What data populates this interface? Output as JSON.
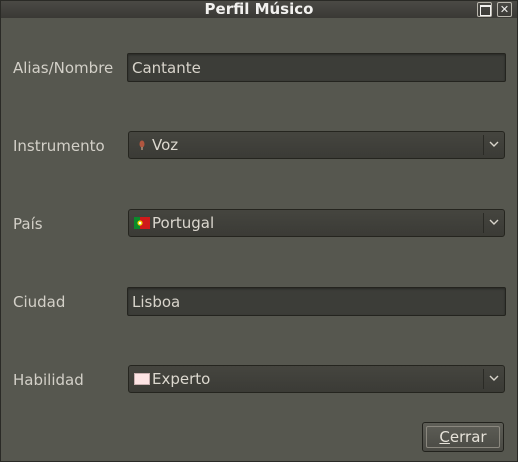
{
  "window": {
    "title": "Perfil Músico",
    "maximize_icon": "maximize-icon",
    "close_icon": "close-icon",
    "close_glyph": "✕"
  },
  "form": {
    "alias": {
      "label": "Alias/Nombre",
      "value": "Cantante"
    },
    "instrumento": {
      "label": "Instrumento",
      "value": "Voz",
      "icon": "microphone-icon"
    },
    "pais": {
      "label": "País",
      "value": "Portugal",
      "icon": "portugal-flag-icon"
    },
    "ciudad": {
      "label": "Ciudad",
      "value": "Lisboa"
    },
    "habilidad": {
      "label": "Habilidad",
      "value": "Experto",
      "icon": "color-swatch-icon",
      "swatch_color": "#fde4e4"
    }
  },
  "buttons": {
    "cerrar_prefix": "C",
    "cerrar_rest": "errar"
  }
}
